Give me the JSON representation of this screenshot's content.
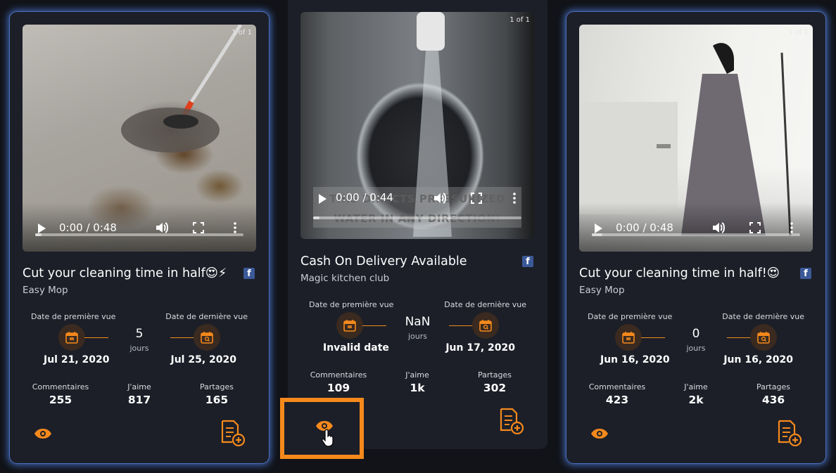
{
  "colors": {
    "accent": "#f5891c",
    "card_bg": "#1c1f28",
    "page_bg": "#111318",
    "glow": "#5082e6"
  },
  "cards": [
    {
      "pager": "1 of 1",
      "time": "0:00 / 0:48",
      "title": "Cut your cleaning time in half😍⚡",
      "subtitle": "Easy Mop",
      "first_seen_label": "Date de première vue",
      "last_seen_label": "Date de dernière vue",
      "days": "5",
      "days_label": "jours",
      "first_seen": "Jul 21, 2020",
      "last_seen": "Jul 25, 2020",
      "comments_label": "Commentaires",
      "comments": "255",
      "likes_label": "J'aime",
      "likes": "817",
      "shares_label": "Partages",
      "shares": "165",
      "progress": 0.03
    },
    {
      "pager": "1 of 1",
      "time": "0:00 / 0:44",
      "video_caption": "THIS DIRECTS PRESSURIZED WATER IN ANY DIRECTION!",
      "title": "Cash On Delivery Available",
      "subtitle": "Magic kitchen club",
      "first_seen_label": "Date de première vue",
      "last_seen_label": "Date de dernière vue",
      "days": "NaN",
      "days_label": "jours",
      "first_seen": "Invalid date",
      "last_seen": "Jun 17, 2020",
      "comments_label": "Commentaires",
      "comments": "109",
      "likes_label": "J'aime",
      "likes": "1k",
      "shares_label": "Partages",
      "shares": "302",
      "progress": 0.03
    },
    {
      "pager": "1 of 1",
      "time": "0:00 / 0:48",
      "title": "Cut your cleaning time in half!😍",
      "subtitle": "Easy Mop",
      "first_seen_label": "Date de première vue",
      "last_seen_label": "Date de dernière vue",
      "days": "0",
      "days_label": "jours",
      "first_seen": "Jun 16, 2020",
      "last_seen": "Jun 16, 2020",
      "comments_label": "Commentaires",
      "comments": "423",
      "likes_label": "J'aime",
      "likes": "2k",
      "shares_label": "Partages",
      "shares": "436",
      "progress": 0.05
    }
  ],
  "icons": {
    "view": "eye-icon",
    "add": "document-add-icon",
    "calendar_first": "calendar-flag-icon",
    "calendar_last": "calendar-search-icon",
    "social": "facebook-icon",
    "cursor": "hand-pointer-icon"
  }
}
